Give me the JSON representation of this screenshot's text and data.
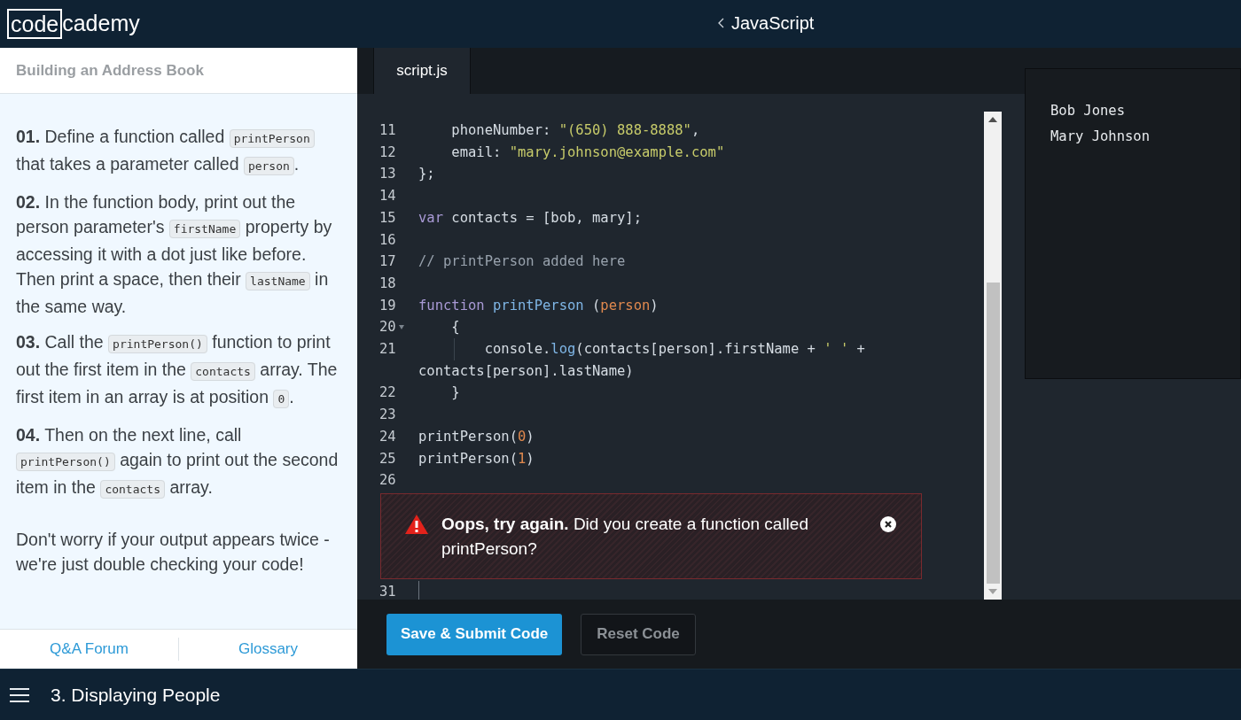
{
  "top_bar": {
    "logo_boxed": "code",
    "logo_rest": "cademy",
    "course": "JavaScript"
  },
  "lesson": {
    "title": "Building an Address Book",
    "steps": [
      {
        "number": "01.",
        "parts": [
          {
            "kind": "text",
            "text": "Define a function called "
          },
          {
            "kind": "code",
            "text": "printPerson"
          },
          {
            "kind": "text",
            "text": " that takes a parameter called "
          },
          {
            "kind": "code",
            "text": "person"
          },
          {
            "kind": "text",
            "text": "."
          }
        ]
      },
      {
        "number": "02.",
        "parts": [
          {
            "kind": "text",
            "text": "In the function body, print out the person parameter's "
          },
          {
            "kind": "code",
            "text": "firstName"
          },
          {
            "kind": "text",
            "text": " property by accessing it with a dot just like before. Then print a space, then their "
          },
          {
            "kind": "code",
            "text": "lastName"
          },
          {
            "kind": "text",
            "text": " in the same way."
          }
        ]
      },
      {
        "number": "03.",
        "parts": [
          {
            "kind": "text",
            "text": "Call the "
          },
          {
            "kind": "code",
            "text": "printPerson()"
          },
          {
            "kind": "text",
            "text": " function to print out the first item in the "
          },
          {
            "kind": "code",
            "text": "contacts"
          },
          {
            "kind": "text",
            "text": " array. The first item in an array is at position "
          },
          {
            "kind": "code",
            "text": "0"
          },
          {
            "kind": "text",
            "text": "."
          }
        ]
      },
      {
        "number": "04.",
        "parts": [
          {
            "kind": "text",
            "text": "Then on the next line, call "
          },
          {
            "kind": "code",
            "text": "printPerson()"
          },
          {
            "kind": "text",
            "text": " again to print out the second item in the "
          },
          {
            "kind": "code",
            "text": "contacts"
          },
          {
            "kind": "text",
            "text": " array."
          }
        ]
      }
    ],
    "note": "Don't worry if your output appears twice - we're just double checking your code!",
    "links": [
      "Q&A Forum",
      "Glossary"
    ]
  },
  "editor": {
    "tab": "script.js",
    "lines": [
      {
        "number": "11",
        "fold": false,
        "tokens": [
          {
            "kind": "plain",
            "text": "    phoneNumber: "
          },
          {
            "kind": "string",
            "text": "\"(650) 888-8888\""
          },
          {
            "kind": "plain",
            "text": ","
          }
        ]
      },
      {
        "number": "12",
        "fold": false,
        "tokens": [
          {
            "kind": "plain",
            "text": "    email: "
          },
          {
            "kind": "string",
            "text": "\"mary.johnson@example.com\""
          }
        ]
      },
      {
        "number": "13",
        "fold": false,
        "tokens": [
          {
            "kind": "plain",
            "text": "};"
          }
        ]
      },
      {
        "number": "14",
        "fold": false
      },
      {
        "number": "15",
        "fold": false,
        "tokens": [
          {
            "kind": "keyword",
            "text": "var"
          },
          {
            "kind": "plain",
            "text": " contacts = [bob, mary];"
          }
        ]
      },
      {
        "number": "16",
        "fold": false
      },
      {
        "number": "17",
        "fold": false,
        "tokens": [
          {
            "kind": "comment",
            "text": "// printPerson added here"
          }
        ]
      },
      {
        "number": "18",
        "fold": false
      },
      {
        "number": "19",
        "fold": false,
        "tokens": [
          {
            "kind": "keyword",
            "text": "function"
          },
          {
            "kind": "func",
            "text": " printPerson"
          },
          {
            "kind": "plain",
            "text": " ("
          },
          {
            "kind": "param",
            "text": "person"
          },
          {
            "kind": "plain",
            "text": ")"
          }
        ]
      },
      {
        "number": "20",
        "fold": true,
        "tokens": [
          {
            "kind": "plain",
            "text": "    {"
          }
        ]
      },
      {
        "number": "21",
        "fold": false,
        "guide": true,
        "tokens": [
          {
            "kind": "plain",
            "text": "        console."
          },
          {
            "kind": "func",
            "text": "log"
          },
          {
            "kind": "plain",
            "text": "(contacts[person].firstName + "
          },
          {
            "kind": "string",
            "text": "' '"
          },
          {
            "kind": "plain",
            "text": " +"
          }
        ]
      },
      {
        "tokens": [
          {
            "kind": "plain",
            "text": "contacts[person].lastName)"
          }
        ]
      },
      {
        "number": "22",
        "fold": false,
        "tokens": [
          {
            "kind": "plain",
            "text": "    }"
          }
        ]
      },
      {
        "number": "23",
        "fold": false
      },
      {
        "number": "24",
        "fold": false,
        "tokens": [
          {
            "kind": "plain",
            "text": "printPerson("
          },
          {
            "kind": "number",
            "text": "0"
          },
          {
            "kind": "plain",
            "text": ")"
          }
        ]
      },
      {
        "number": "25",
        "fold": false,
        "tokens": [
          {
            "kind": "plain",
            "text": "printPerson("
          },
          {
            "kind": "number",
            "text": "1"
          },
          {
            "kind": "plain",
            "text": ")"
          }
        ]
      },
      {
        "number": "26",
        "fold": false
      }
    ],
    "error": {
      "lead": "Oops, try again.",
      "message": "Did you create a function called printPerson?"
    },
    "last_line": "31",
    "buttons": [
      {
        "label": "Save & Submit Code",
        "kind": "primary"
      },
      {
        "label": "Reset Code",
        "kind": "secondary"
      }
    ]
  },
  "output": [
    "Bob Jones",
    "Mary Johnson"
  ],
  "bottom_bar": {
    "exercise": "3. Displaying People"
  }
}
